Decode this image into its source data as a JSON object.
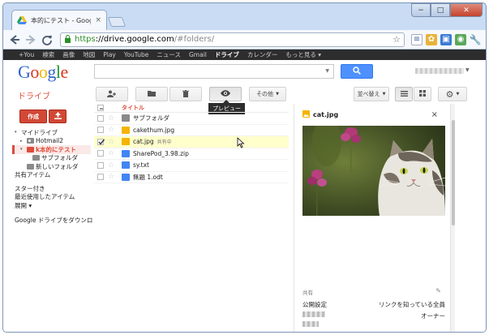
{
  "browser": {
    "tab_title": "本的にテスト - Google D",
    "tab_close": "×",
    "url_https": "https",
    "url_host": "://drive.google.com",
    "url_path": "/#folders/",
    "window_min": "−",
    "window_max": "□",
    "window_close": "✕"
  },
  "gbar": {
    "items": [
      "+You",
      "検索",
      "画像",
      "地図",
      "Play",
      "YouTube",
      "ニュース",
      "Gmail",
      "ドライブ",
      "カレンダー",
      "もっと見る ▾"
    ],
    "active_index": 8
  },
  "header": {
    "logo": "Google"
  },
  "actionbar": {
    "app_title": "ドライブ",
    "more_label": "その他",
    "sort_label": "並べ替え",
    "tooltip": "プレビュー"
  },
  "leftnav": {
    "create_label": "作成",
    "items": [
      {
        "label": "マイドライブ",
        "caret": "▾",
        "level": 0,
        "active": false
      },
      {
        "label": "Hotmail2",
        "caret": "▸",
        "level": 1,
        "active": false
      },
      {
        "label": "k本的にテスト",
        "caret": "▾",
        "level": 1,
        "active": true
      },
      {
        "label": "サブフォルダ",
        "caret": "",
        "level": 2,
        "active": false
      },
      {
        "label": "新しいフォルダ",
        "caret": "",
        "level": 1,
        "active": false
      },
      {
        "label": "共有アイテム",
        "caret": "",
        "level": 0,
        "active": false
      },
      {
        "label": "スター付き",
        "caret": "",
        "level": 0,
        "active": false
      },
      {
        "label": "最近使用したアイテム",
        "caret": "",
        "level": 0,
        "active": false
      },
      {
        "label": "展開 ▾",
        "caret": "",
        "level": 0,
        "active": false
      },
      {
        "label": "Google ドライブをダウンロ",
        "caret": "",
        "level": 0,
        "active": false
      }
    ]
  },
  "filelist": {
    "column_title": "タイトル",
    "rows": [
      {
        "name": "サブフォルダ",
        "type": "folder",
        "selected": false,
        "shared": ""
      },
      {
        "name": "cakethum.jpg",
        "type": "image",
        "selected": false,
        "shared": ""
      },
      {
        "name": "cat.jpg",
        "type": "image",
        "selected": true,
        "shared": "共有中"
      },
      {
        "name": "SharePod_3.98.zip",
        "type": "file",
        "selected": false,
        "shared": ""
      },
      {
        "name": "sy.txt",
        "type": "file",
        "selected": false,
        "shared": ""
      },
      {
        "name": "無題 1.odt",
        "type": "doc",
        "selected": false,
        "shared": ""
      }
    ]
  },
  "preview": {
    "title": "cat.jpg",
    "close": "×",
    "share_label": "共有",
    "visibility_label": "公開設定",
    "visibility_value": "リンクを知っている全員",
    "owner_value": "オーナー"
  },
  "colors": {
    "accent_red": "#dd4b39",
    "blue_button": "#4d90fe",
    "gbar_bg": "#2d2d2d"
  }
}
